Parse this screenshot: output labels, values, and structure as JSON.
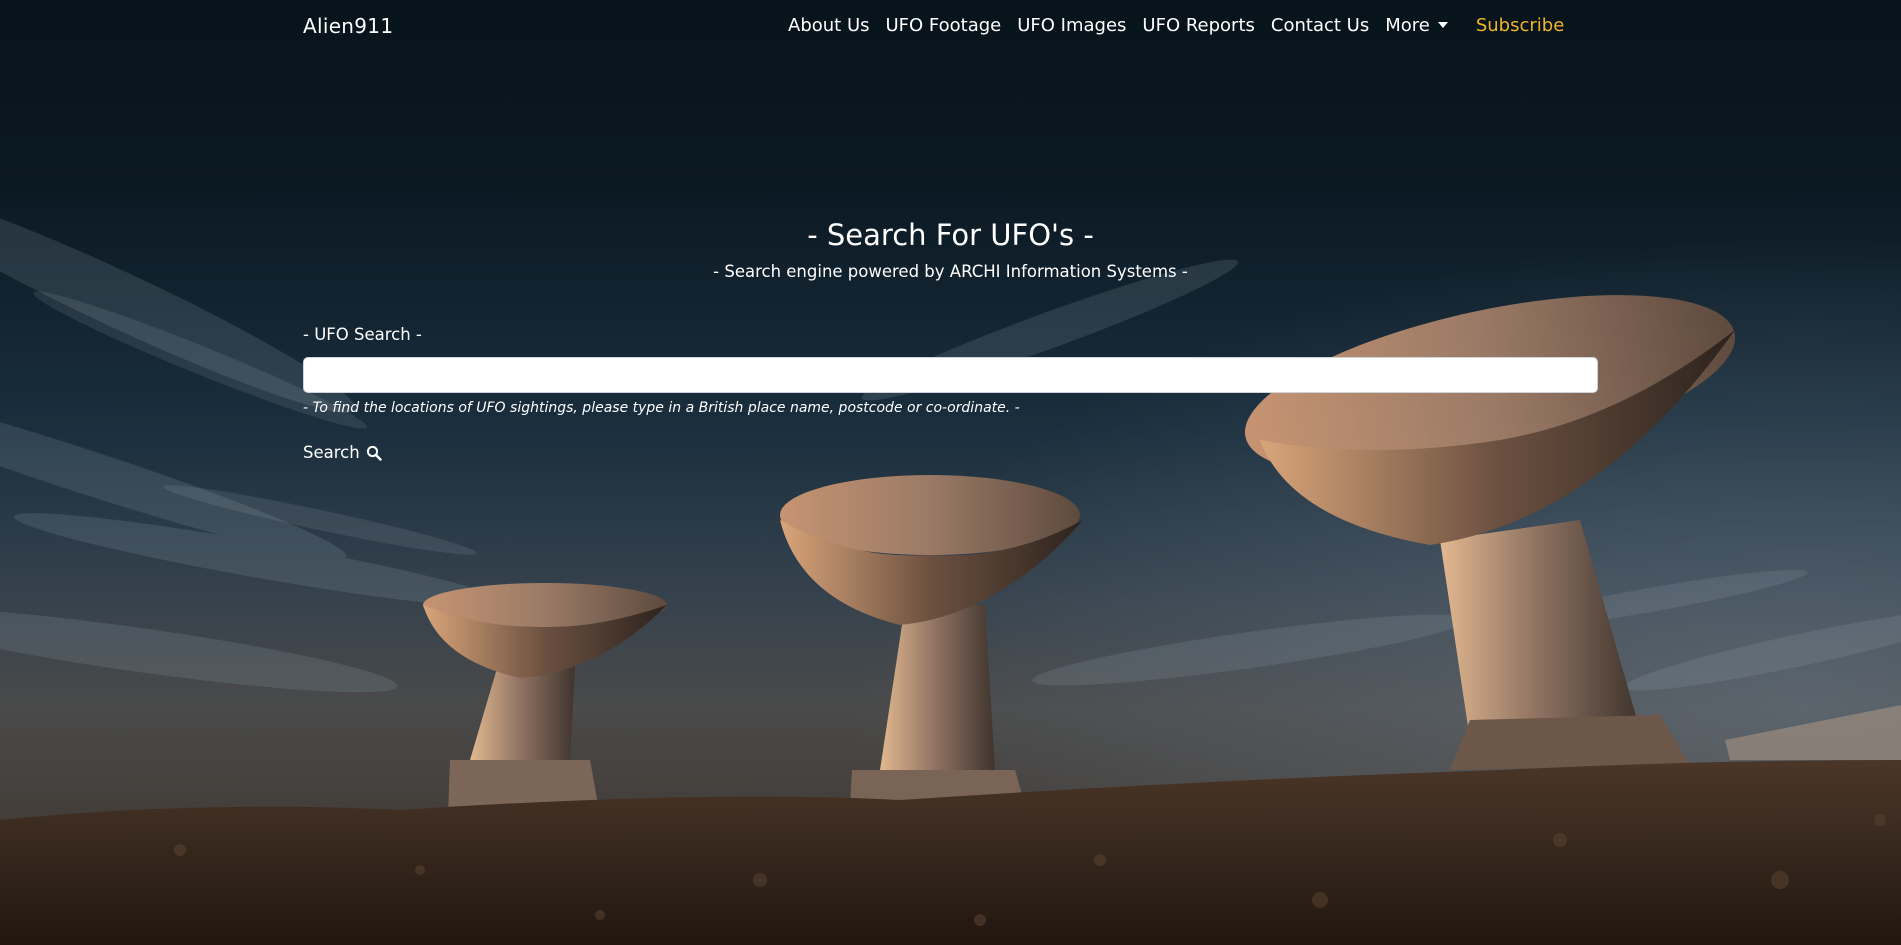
{
  "navbar": {
    "brand": "Alien911",
    "links": [
      {
        "label": "About Us"
      },
      {
        "label": "UFO Footage"
      },
      {
        "label": "UFO Images"
      },
      {
        "label": "UFO Reports"
      },
      {
        "label": "Contact Us"
      }
    ],
    "more_label": "More",
    "subscribe_label": "Subscribe",
    "subscribe_color": "#f0b429"
  },
  "hero": {
    "title": "- Search For UFO's -",
    "subtitle": "- Search engine powered by ARCHI Information Systems -"
  },
  "search": {
    "label": "- UFO Search -",
    "value": "",
    "placeholder": "",
    "help_text": "- To find the locations of UFO sightings, please type in a British place name, postcode or co-ordinate. -",
    "button_label": "Search",
    "button_icon": "search-icon"
  },
  "background": {
    "image": "radio-telescope-dishes-at-dusk"
  }
}
